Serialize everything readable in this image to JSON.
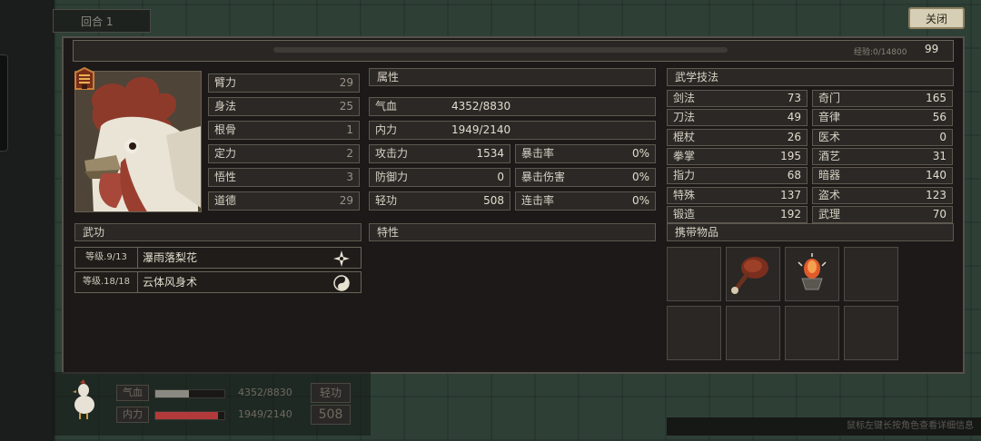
{
  "round_label": "回合 1",
  "close_label": "关闭",
  "exp_text": "经验:0/14800",
  "level": "99",
  "attributes": [
    {
      "label": "臂力",
      "value": "29"
    },
    {
      "label": "身法",
      "value": "25"
    },
    {
      "label": "根骨",
      "value": "1"
    },
    {
      "label": "定力",
      "value": "2"
    },
    {
      "label": "悟性",
      "value": "3"
    },
    {
      "label": "道德",
      "value": "29"
    }
  ],
  "props": {
    "header": "属性",
    "qixue": {
      "label": "气血",
      "value": "4352/8830"
    },
    "neili": {
      "label": "内力",
      "value": "1949/2140"
    },
    "gongji": {
      "label": "攻击力",
      "value": "1534"
    },
    "fangyu": {
      "label": "防御力",
      "value": "0"
    },
    "qinggong": {
      "label": "轻功",
      "value": "508"
    },
    "baoji": {
      "label": "暴击率",
      "value": "0%"
    },
    "baoshang": {
      "label": "暴击伤害",
      "value": "0%"
    },
    "lianji": {
      "label": "连击率",
      "value": "0%"
    }
  },
  "martial": {
    "header": "武学技法",
    "left": [
      {
        "label": "剑法",
        "value": "73"
      },
      {
        "label": "刀法",
        "value": "49"
      },
      {
        "label": "棍杖",
        "value": "26"
      },
      {
        "label": "拳掌",
        "value": "195"
      },
      {
        "label": "指力",
        "value": "68"
      },
      {
        "label": "特殊",
        "value": "137"
      },
      {
        "label": "锻造",
        "value": "192"
      }
    ],
    "right": [
      {
        "label": "奇门",
        "value": "165"
      },
      {
        "label": "音律",
        "value": "56"
      },
      {
        "label": "医术",
        "value": "0"
      },
      {
        "label": "酒艺",
        "value": "31"
      },
      {
        "label": "暗器",
        "value": "140"
      },
      {
        "label": "盗术",
        "value": "123"
      },
      {
        "label": "武理",
        "value": "70"
      }
    ]
  },
  "wugong": {
    "header": "武功",
    "items": [
      {
        "level": "等级.9/13",
        "name": "瀑雨落梨花",
        "icon": "shuriken-icon"
      },
      {
        "level": "等级.18/18",
        "name": "云体风身术",
        "icon": "yin-yang-icon"
      }
    ]
  },
  "traits_header": "特性",
  "items_header": "携带物品",
  "inventory": [
    "roast-meat-icon",
    "incense-burner-icon",
    "",
    "",
    "",
    "",
    "",
    ""
  ],
  "hud": {
    "qixue_label": "气血",
    "neili_label": "内力",
    "qixue_value": "4352/8830",
    "neili_value": "1949/2140",
    "qinggong_label": "轻功",
    "qinggong_value": "508",
    "qixue_fraction": 0.49,
    "neili_fraction": 0.91
  },
  "hint": "鼠标左键长按角色查看详细信息",
  "colors": {
    "hp": "#8a8a82",
    "mp": "#b23a3a",
    "accent": "#d6cfb6"
  }
}
